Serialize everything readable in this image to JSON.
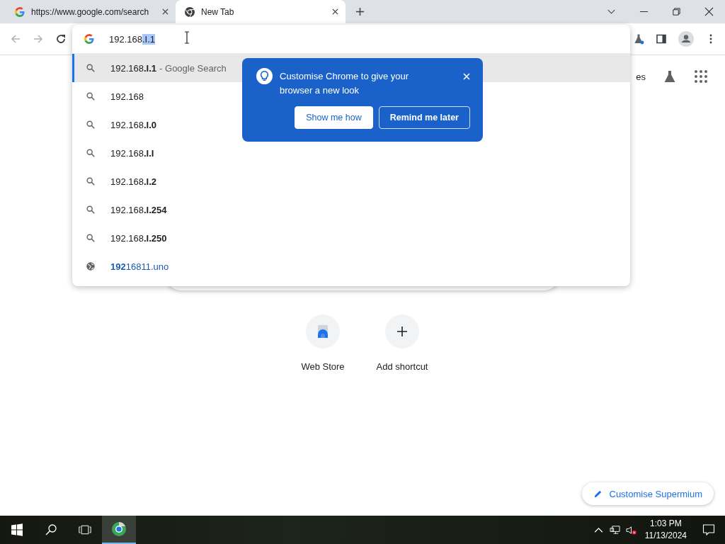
{
  "tabs": [
    {
      "title": "https://www.google.com/search",
      "selected": false
    },
    {
      "title": "New Tab",
      "selected": true
    }
  ],
  "omnibox": {
    "text": "192.168",
    "completion": ".I.1"
  },
  "suggestions": [
    {
      "kind": "search",
      "text": "192.168**.I.1**",
      "suffix": "- Google Search",
      "selected": true
    },
    {
      "kind": "search",
      "text": "192.168",
      "selected": false
    },
    {
      "kind": "search",
      "text": "192.168**.I.0**",
      "selected": false
    },
    {
      "kind": "search",
      "text": "192.168**.I.I**",
      "selected": false
    },
    {
      "kind": "search",
      "text": "192.168**.I.2**",
      "selected": false
    },
    {
      "kind": "search",
      "text": "192.168**.I.254**",
      "selected": false
    },
    {
      "kind": "search",
      "text": "192.168**.I.250**",
      "selected": false
    },
    {
      "kind": "url",
      "text": "**192**16811.uno",
      "selected": false
    }
  ],
  "promo": {
    "title": "Customise Chrome to give your browser a new look",
    "buttons": [
      {
        "label": "Show me how",
        "kind": "filled"
      },
      {
        "label": "Remind me later",
        "kind": "outlined"
      }
    ]
  },
  "page": {
    "header_text": "es",
    "shortcuts": [
      {
        "label": "Web Store",
        "kind": "store"
      },
      {
        "label": "Add shortcut",
        "kind": "add"
      }
    ],
    "customise_button": "Customise Supermium"
  },
  "taskbar": {
    "time": "1:03 PM",
    "date": "11/13/2024"
  }
}
